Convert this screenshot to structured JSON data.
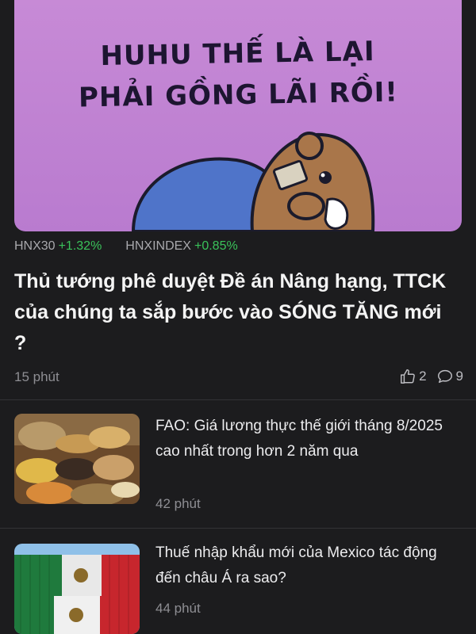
{
  "hero": {
    "caption": "HUHU THẾ LÀ LẠI\nPHẢI GỒNG LÃI RỒI!",
    "background": "#c78ad6"
  },
  "tickers": [
    {
      "name": "HNX30",
      "change": "+1.32%"
    },
    {
      "name": "HNXINDEX",
      "change": "+0.85%"
    }
  ],
  "headline": {
    "title": "Thủ tướng phê duyệt Đề án Nâng hạng, TTCK của chúng ta sắp bước vào SÓNG TĂNG mới ?",
    "time": "15 phút",
    "likes": "2",
    "comments": "9",
    "like_icon": "thumbs-up-icon",
    "comment_icon": "comment-icon"
  },
  "articles": [
    {
      "title": "FAO: Giá lương thực thế giới tháng 8/2025 cao nhất trong hơn 2 năm qua",
      "time": "42 phút"
    },
    {
      "title": "Thuế nhập khẩu mới của Mexico tác động đến châu Á ra sao?",
      "time": "44 phút"
    }
  ],
  "colors": {
    "positive": "#3ac25a",
    "background": "#1c1c1e"
  }
}
